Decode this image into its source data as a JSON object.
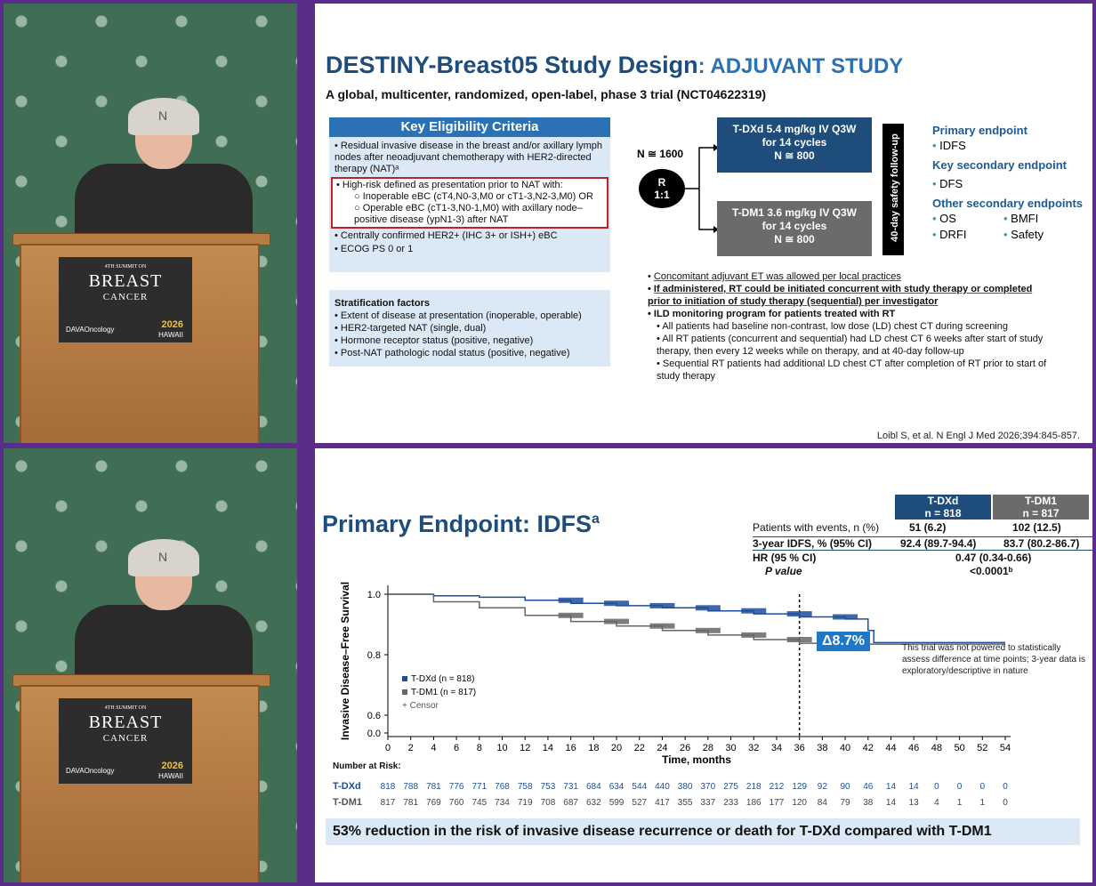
{
  "slide1": {
    "title_main": "DESTINY-Breast05 Study Design",
    "title_sub": ": ADJUVANT STUDY",
    "subtitle": "A global, multicenter, randomized, open-label, phase 3 trial (NCT04622319)",
    "kec_header": "Key Eligibility Criteria",
    "kec_items": [
      "• Residual invasive disease in the breast and/or axillary lymph nodes after neoadjuvant chemotherapy with HER2-directed therapy (NAT)ᵃ",
      "• High-risk defined as presentation prior to NAT with:",
      "○ Inoperable eBC (cT4,N0-3,M0 or cT1-3,N2-3,M0) OR",
      "○ Operable eBC (cT1-3,N0-1,M0) with axillary node–positive disease (ypN1-3) after NAT",
      "• Centrally confirmed HER2+ (IHC 3+ or ISH+) eBC",
      "• ECOG PS 0 or 1"
    ],
    "strat_title": "Stratification factors",
    "strat_items": [
      "• Extent of disease at presentation (inoperable, operable)",
      "• HER2-targeted NAT (single, dual)",
      "• Hormone receptor status (positive, negative)",
      "• Post-NAT pathologic nodal status (positive, negative)"
    ],
    "n_label": "N ≅ 1600",
    "r_label": "R",
    "r_ratio": "1:1",
    "arm1": [
      "T-DXd 5.4 mg/kg IV Q3W",
      "for 14 cycles",
      "N ≅ 800"
    ],
    "arm2": [
      "T-DM1 3.6 mg/kg IV Q3W",
      "for 14 cycles",
      "N ≅ 800"
    ],
    "followup": "40-day safety follow-up",
    "primary_h": "Primary endpoint",
    "primary": "IDFS",
    "keysec_h": "Key secondary endpoint",
    "keysec": "DFS",
    "other_h": "Other secondary endpoints",
    "other": [
      "OS",
      "BMFI",
      "DRFI",
      "Safety"
    ],
    "notes": [
      "Concomitant adjuvant ET was allowed per local practices",
      "If administered, RT could be initiated concurrent with study therapy or completed prior to initiation of study therapy (sequential) per investigator",
      "ILD monitoring program for patients treated with RT",
      "All patients had baseline non-contrast, low dose (LD) chest CT during screening",
      "All RT patients (concurrent and sequential) had LD chest CT 6 weeks after start of study therapy, then every 12 weeks while on therapy, and at 40-day follow-up",
      "Sequential RT patients had additional LD chest CT after completion of RT prior to start of study therapy"
    ],
    "reference": "Loibl S, et al. N Engl J Med 2026;394:845-857."
  },
  "slide2": {
    "title": "Primary Endpoint: IDFS",
    "title_sup": "a",
    "col1": [
      "T-DXd",
      "n = 818"
    ],
    "col2": [
      "T-DM1",
      "n = 817"
    ],
    "rows": [
      {
        "label": "Patients with events, n (%)",
        "v1": "51 (6.2)",
        "v2": "102 (12.5)"
      },
      {
        "label": "3-year IDFS, % (95% CI)",
        "v1": "92.4 (89.7-94.4)",
        "v2": "83.7 (80.2-86.7)"
      },
      {
        "label": "HR (95 % CI)",
        "v": "0.47 (0.34-0.66)"
      },
      {
        "label": "P value",
        "v": "<0.0001ᵇ"
      }
    ],
    "delta": "Δ8.7%",
    "note": "This trial was not powered to statistically assess difference at time points; 3-year data is exploratory/descriptive in nature",
    "legend": [
      "T-DXd (n = 818)",
      "T-DM1 (n = 817)",
      "+ Censor"
    ],
    "risk_title": "Number at Risk:",
    "risk_label1": "T-DXd",
    "risk_label2": "T-DM1",
    "risk1": [
      "818",
      "788",
      "781",
      "776",
      "771",
      "768",
      "758",
      "753",
      "731",
      "684",
      "634",
      "544",
      "440",
      "380",
      "370",
      "275",
      "218",
      "212",
      "129",
      "92",
      "90",
      "46",
      "14",
      "14",
      "0",
      "0",
      "0",
      "0"
    ],
    "risk2": [
      "817",
      "781",
      "769",
      "760",
      "745",
      "734",
      "719",
      "708",
      "687",
      "632",
      "599",
      "527",
      "417",
      "355",
      "337",
      "233",
      "186",
      "177",
      "120",
      "84",
      "79",
      "38",
      "14",
      "13",
      "4",
      "1",
      "1",
      "0"
    ],
    "bottom": "53% reduction in the risk of invasive disease recurrence or death for T-DXd compared with T-DM1"
  },
  "sign": {
    "l1": "4TH SUMMIT ON",
    "l2": "BREAST",
    "l3": "CANCER",
    "l4": "DAVAOncology",
    "l5": "2026",
    "l6": "HAWAII"
  },
  "chart_data": {
    "type": "line",
    "title": "",
    "xlabel": "Time, months",
    "ylabel": "Invasive Disease–Free Survival",
    "xlim": [
      0,
      54
    ],
    "ylim": [
      0,
      1.0
    ],
    "x_ticks": [
      0,
      2,
      4,
      6,
      8,
      10,
      12,
      14,
      16,
      18,
      20,
      22,
      24,
      26,
      28,
      30,
      32,
      34,
      36,
      38,
      40,
      42,
      44,
      46,
      48,
      50,
      52,
      54
    ],
    "y_ticks": [
      0.0,
      0.6,
      0.8,
      1.0
    ],
    "colors": {
      "tdxd": "#1f4e9a",
      "tdm1": "#666666"
    },
    "series": [
      {
        "name": "T-DXd (n = 818)",
        "x": [
          0,
          4,
          8,
          12,
          16,
          20,
          24,
          28,
          32,
          36,
          40,
          42,
          42.5,
          54
        ],
        "y": [
          1.0,
          0.995,
          0.99,
          0.98,
          0.97,
          0.962,
          0.955,
          0.945,
          0.935,
          0.925,
          0.918,
          0.88,
          0.84,
          0.84
        ]
      },
      {
        "name": "T-DM1 (n = 817)",
        "x": [
          0,
          4,
          8,
          12,
          16,
          20,
          24,
          28,
          32,
          36,
          40,
          44,
          54
        ],
        "y": [
          1.0,
          0.975,
          0.955,
          0.93,
          0.91,
          0.895,
          0.88,
          0.865,
          0.85,
          0.838,
          0.835,
          0.835,
          0.835
        ]
      }
    ],
    "reference_x": 36
  }
}
